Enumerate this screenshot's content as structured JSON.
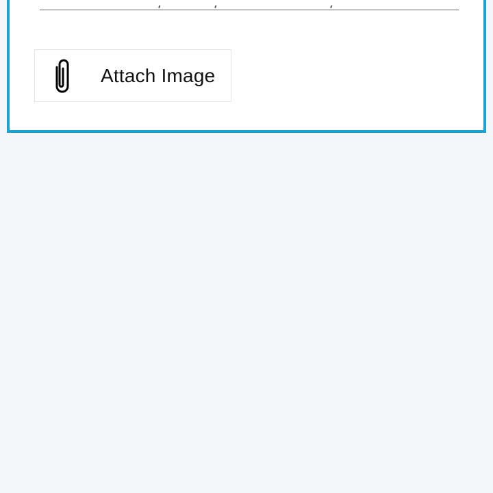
{
  "attach_button": {
    "label": "Attach Image",
    "icon": "paperclip-icon"
  },
  "colors": {
    "page_background": "#f3f7f9",
    "card_border": "#1aa1d4",
    "button_border": "#dfe4e6",
    "text": "#111111"
  }
}
